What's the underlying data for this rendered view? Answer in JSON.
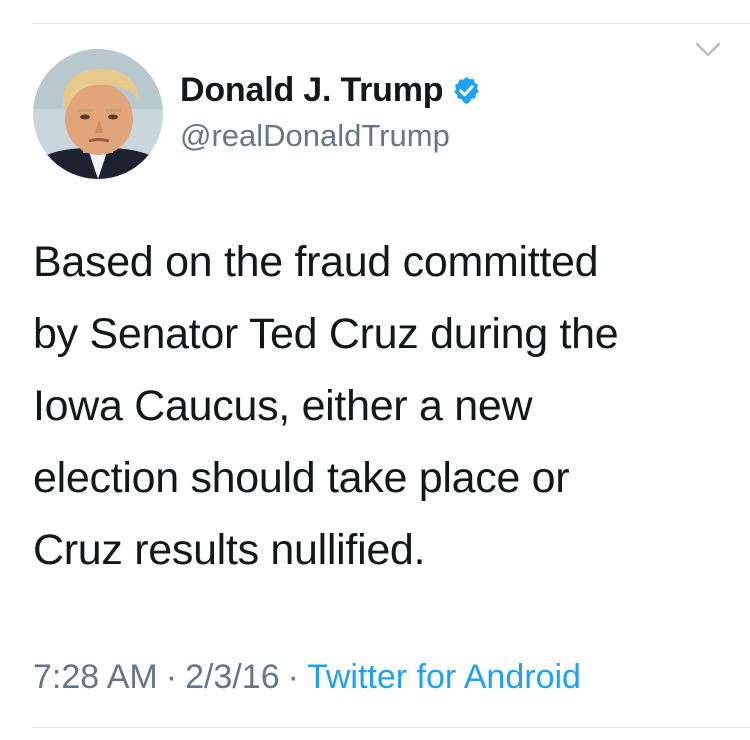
{
  "author": {
    "display_name": "Donald J. Trump",
    "handle": "@realDonaldTrump",
    "verified": true,
    "avatar_icon": "profile-photo"
  },
  "menu_icon": "chevron-down-icon",
  "tweet": {
    "lines": [
      "Based on the fraud committed",
      "by Senator Ted Cruz during the",
      "Iowa Caucus, either a new",
      "election should take place or",
      "Cruz results nullified."
    ]
  },
  "meta": {
    "time": "7:28 AM",
    "separator": "·",
    "date": "2/3/16",
    "source": "Twitter for Android"
  },
  "colors": {
    "text": "#14171a",
    "secondary": "#657786",
    "link": "#1da1f2",
    "verified_badge": "#1da1f2",
    "divider": "#e1e8ed"
  }
}
